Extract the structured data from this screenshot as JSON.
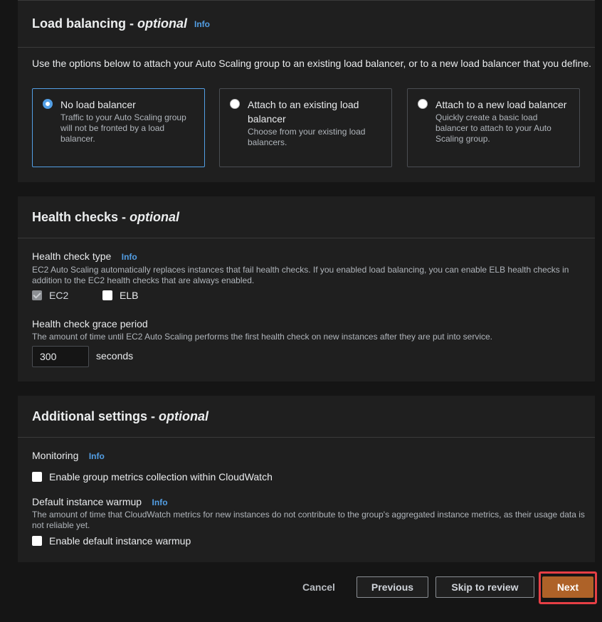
{
  "load_balancing": {
    "title": "Load balancing - ",
    "title_optional": "optional",
    "info": "Info",
    "description": "Use the options below to attach your Auto Scaling group to an existing load balancer, or to a new load balancer that you define.",
    "options": [
      {
        "title": "No load balancer",
        "description": "Traffic to your Auto Scaling group will not be fronted by a load balancer.",
        "selected": true
      },
      {
        "title": "Attach to an existing load balancer",
        "description": "Choose from your existing load balancers.",
        "selected": false
      },
      {
        "title": "Attach to a new load balancer",
        "description": "Quickly create a basic load balancer to attach to your Auto Scaling group.",
        "selected": false
      }
    ]
  },
  "health_checks": {
    "title": "Health checks - ",
    "title_optional": "optional",
    "type_label": "Health check type",
    "info": "Info",
    "type_description": "EC2 Auto Scaling automatically replaces instances that fail health checks. If you enabled load balancing, you can enable ELB health checks in addition to the EC2 health checks that are always enabled.",
    "ec2_label": "EC2",
    "elb_label": "ELB",
    "grace_label": "Health check grace period",
    "grace_description": "The amount of time until EC2 Auto Scaling performs the first health check on new instances after they are put into service.",
    "grace_value": "300",
    "grace_unit": "seconds"
  },
  "additional_settings": {
    "title": "Additional settings - ",
    "title_optional": "optional",
    "monitoring_label": "Monitoring",
    "info": "Info",
    "monitoring_checkbox": "Enable group metrics collection within CloudWatch",
    "warmup_label": "Default instance warmup",
    "warmup_description": "The amount of time that CloudWatch metrics for new instances do not contribute to the group's aggregated instance metrics, as their usage data is not reliable yet.",
    "warmup_checkbox": "Enable default instance warmup"
  },
  "footer": {
    "cancel": "Cancel",
    "previous": "Previous",
    "skip": "Skip to review",
    "next": "Next"
  },
  "colors": {
    "accent": "#539fe5",
    "next_button": "#ae6228",
    "highlight": "#e53f45"
  }
}
